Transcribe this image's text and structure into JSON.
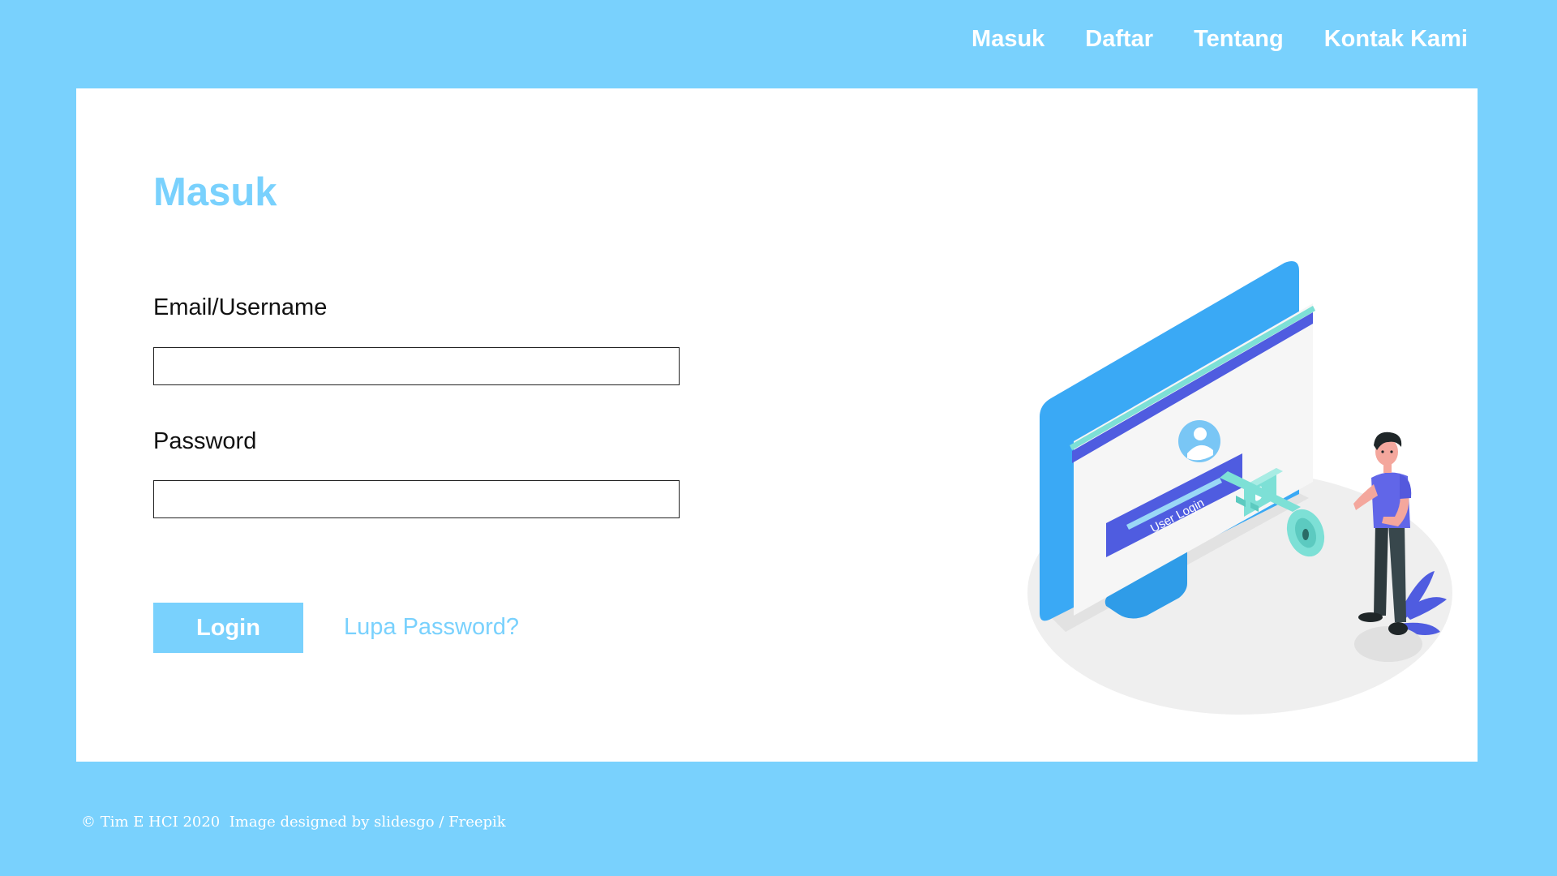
{
  "nav": {
    "items": [
      {
        "label": "Masuk"
      },
      {
        "label": "Daftar"
      },
      {
        "label": "Tentang"
      },
      {
        "label": "Kontak Kami"
      }
    ]
  },
  "form": {
    "title": "Masuk",
    "email_label": "Email/Username",
    "email_value": "",
    "password_label": "Password",
    "password_value": "",
    "login_button": "Login",
    "forgot_link": "Lupa Password?"
  },
  "illustration": {
    "icon": "user-login-illustration",
    "screen_text": "User Login"
  },
  "footer": {
    "text": "© Tim E HCI 2020  Image designed by slidesgo / Freepik"
  },
  "colors": {
    "background": "#79d1fd",
    "accent": "#79d1fd",
    "card": "#ffffff",
    "monitor": "#3aa9f5",
    "screen_header": "#4f5ce0",
    "button_panel": "#4f5ce0",
    "shirt": "#6166e8",
    "floor_shadow": "#efefef"
  }
}
